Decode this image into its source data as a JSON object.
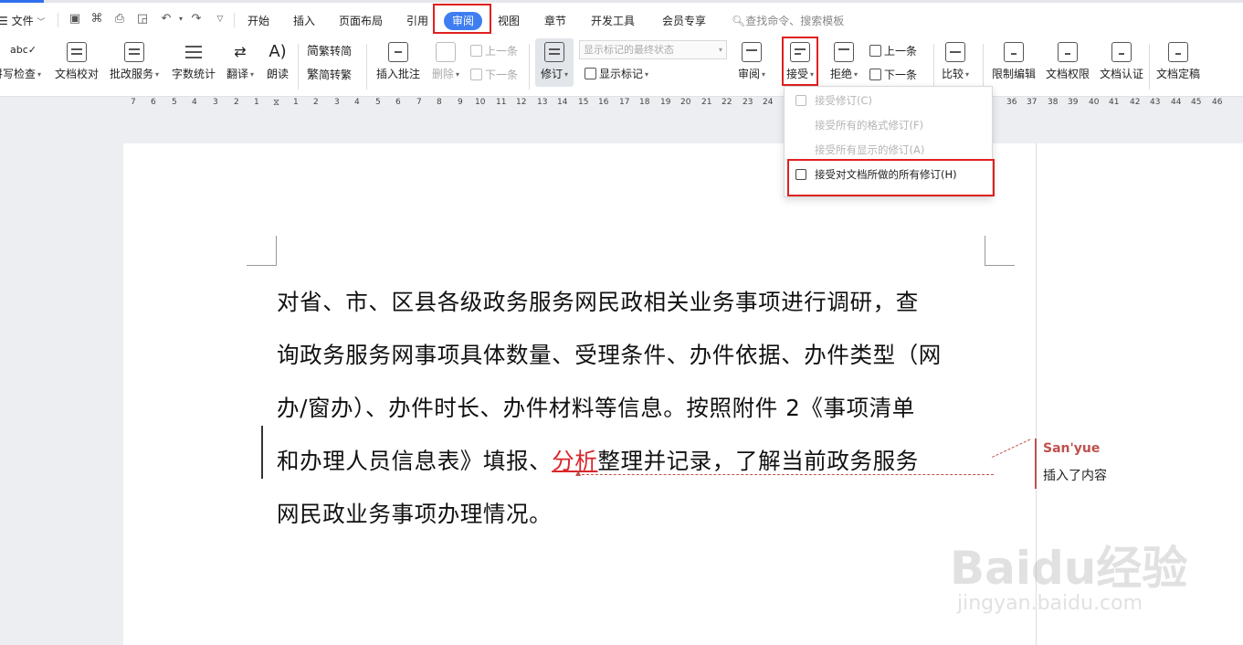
{
  "menubar": {
    "file": "文件",
    "tabs": [
      "开始",
      "插入",
      "页面布局",
      "引用",
      "审阅",
      "视图",
      "章节",
      "开发工具",
      "会员专享"
    ],
    "active_tab": "审阅",
    "search_placeholder": "查找命令、搜索模板"
  },
  "ribbon": {
    "spell_check": "拼写检查",
    "doc_proofread": "文档校对",
    "batch_service": "批改服务",
    "word_count": "字数统计",
    "translate": "翻译",
    "read_aloud": "朗读",
    "trad_to_simp": "繁转简",
    "simp_to_trad": "简转繁",
    "insert_comment": "插入批注",
    "delete": "删除",
    "prev_comment": "上一条",
    "next_comment": "下一条",
    "track_changes": "修订",
    "show_state": "显示标记的最终状态",
    "show_markup": "显示标记",
    "review": "审阅",
    "accept": "接受",
    "reject": "拒绝",
    "prev_change": "上一条",
    "next_change": "下一条",
    "compare": "比较",
    "restrict_edit": "限制编辑",
    "doc_permission": "文档权限",
    "doc_certify": "文档认证",
    "doc_finalize": "文档定稿"
  },
  "ruler": {
    "left_ticks": [
      "7",
      "6",
      "5",
      "4",
      "3",
      "2",
      "1"
    ],
    "right_ticks": [
      "1",
      "2",
      "3",
      "4",
      "5",
      "6",
      "7",
      "8",
      "9",
      "10",
      "11",
      "12",
      "13",
      "14",
      "15",
      "16",
      "17",
      "18",
      "19",
      "20",
      "21",
      "22",
      "23",
      "24"
    ],
    "far_right_ticks": [
      "36",
      "37",
      "38",
      "39",
      "40",
      "41",
      "42",
      "43",
      "44",
      "45",
      "46"
    ]
  },
  "accept_menu": {
    "items": [
      {
        "label": "接受修订(C)",
        "enabled": false
      },
      {
        "label": "接受所有的格式修订(F)",
        "enabled": false
      },
      {
        "label": "接受所有显示的修订(A)",
        "enabled": false
      },
      {
        "label": "接受对文档所做的所有修订(H)",
        "enabled": true
      }
    ]
  },
  "document": {
    "line1": "对省、市、区县各级政务服务网民政相关业务事项进行调研，查",
    "line2": "询政务服务网事项具体数量、受理条件、办件依据、办件类型（网",
    "line3": "办/窗办）、办件时长、办件材料等信息。按照附件 2《事项清单",
    "line4_before": "和办理人员信息表》填报、",
    "line4_insert": "分析",
    "line4_after": "整理并记录，了解当前政务服务",
    "line5": "网民政业务事项办理情况。"
  },
  "comment": {
    "author": "San'yue",
    "text": "插入了内容"
  },
  "watermark": {
    "brand": "Baidu经验",
    "url": "jingyan.baidu.com"
  },
  "colors": {
    "accent": "#3f7ef0",
    "highlight_box": "#e02020",
    "insertion": "#d9262b",
    "comment_author": "#c0504d"
  }
}
